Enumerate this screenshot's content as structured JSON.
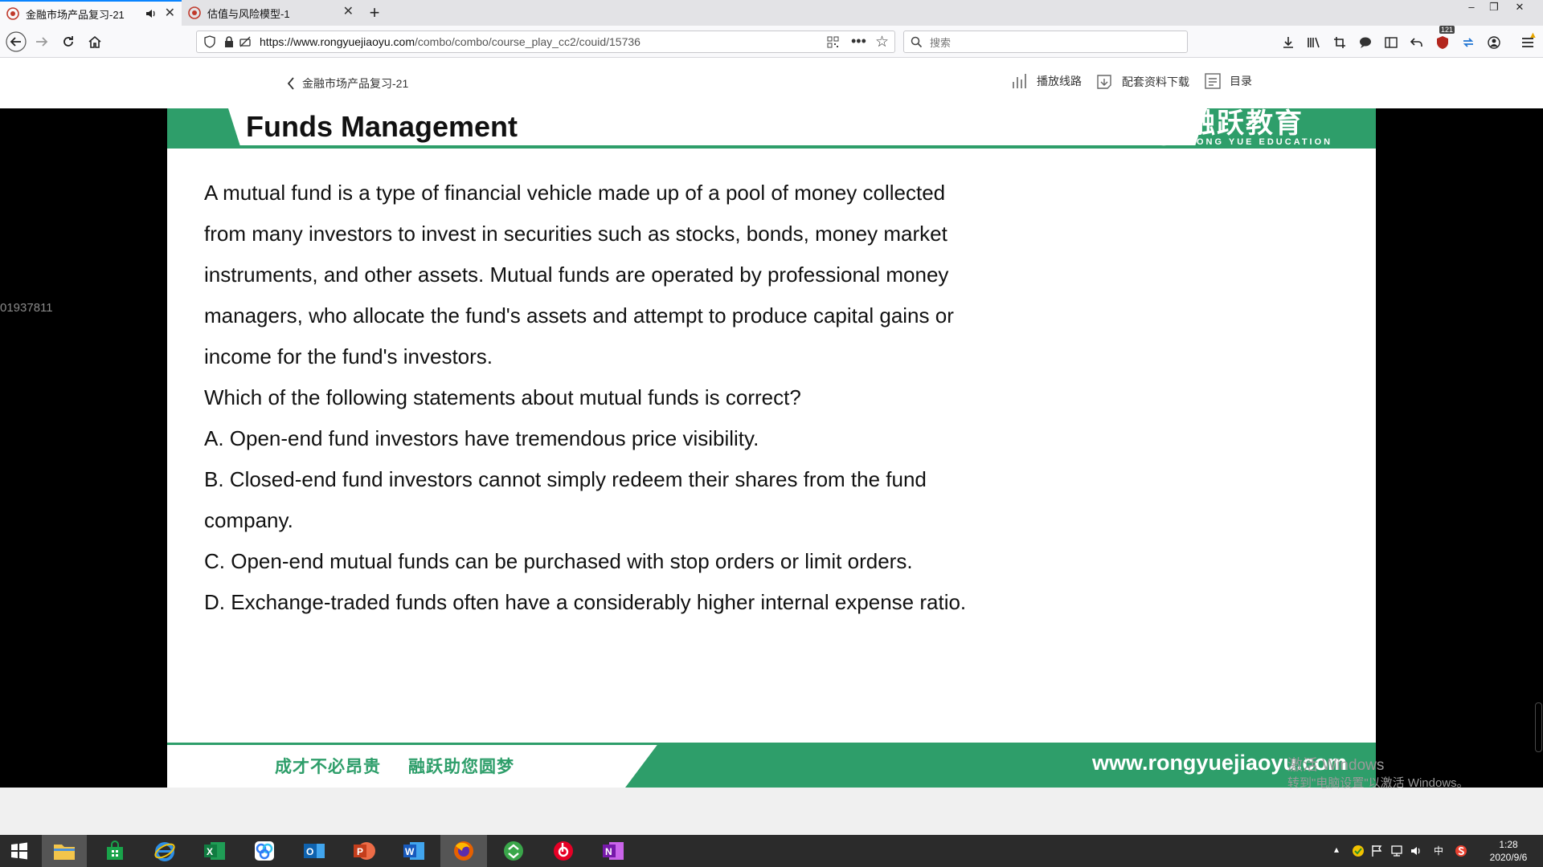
{
  "browser": {
    "tabs": [
      {
        "label": "金融市场产品复习-21",
        "active": true
      },
      {
        "label": "估值与风险模型-1",
        "active": false
      }
    ],
    "url": {
      "host": "https://www.rongyuejiaoyu.com",
      "path": "/combo/combo/course_play_cc2/couid/15736"
    },
    "search_placeholder": "搜索",
    "badge_count": "121"
  },
  "site_header": {
    "back_label": "金融市场产品复习-21",
    "links": [
      "播放线路",
      "配套资料下载",
      "目录"
    ]
  },
  "player": {
    "side_id": "01937811",
    "slide": {
      "title": "Funds Management",
      "logo_cn": "融跃教育",
      "logo_en": "RONG YUE EDUCATION",
      "lines": [
        "A mutual fund is a type of financial vehicle made up of a pool of money collected",
        "from many investors to invest in securities such as stocks, bonds, money market",
        "instruments, and other assets. Mutual funds are operated by professional money",
        "managers, who allocate the fund's assets and attempt to produce capital gains or",
        "income for the fund's investors.",
        "Which of the following statements about mutual funds is correct?",
        "A. Open-end fund investors have tremendous price visibility.",
        "B. Closed-end fund investors cannot simply redeem their shares from the fund",
        "company.",
        "C. Open-end mutual funds can be purchased with stop orders or limit orders.",
        "D. Exchange-traded funds often have a considerably higher internal expense ratio."
      ],
      "slogan_1": "成才不必昂贵",
      "slogan_2": "融跃助您圆梦",
      "website": "www.rongyuejiaoyu.com"
    }
  },
  "watermark": {
    "line1": "激活 Windows",
    "line2": "转到\"电脑设置\"以激活 Windows。"
  },
  "taskbar": {
    "ime": "中",
    "time": "1:28",
    "date": "2020/9/6"
  },
  "colors": {
    "brand_green": "#2e9e6a",
    "tab_accent": "#0a84ff"
  }
}
